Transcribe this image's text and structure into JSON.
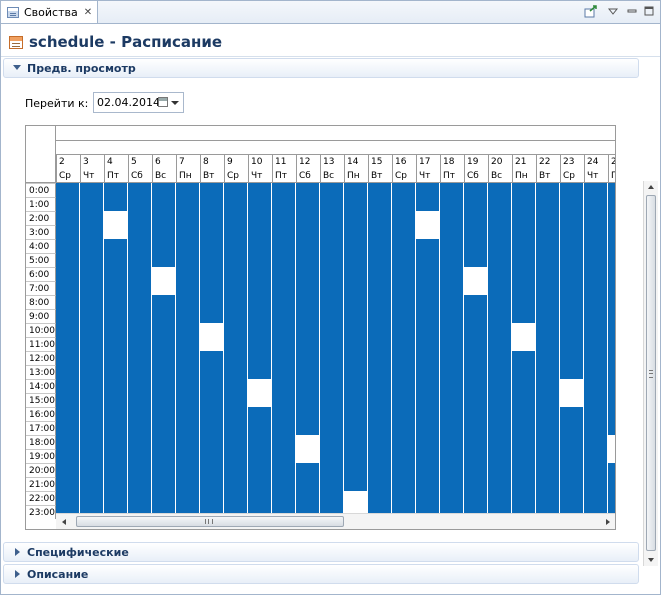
{
  "tab": {
    "label": "Свойства",
    "close": "✕"
  },
  "title": {
    "text": "schedule - Расписание"
  },
  "sections": {
    "preview": "Предв. просмотр",
    "specific": "Специфические",
    "description": "Описание"
  },
  "goto": {
    "label": "Перейти к:",
    "date": "02.04.2014"
  },
  "schedule": {
    "days": [
      {
        "n": "2",
        "w": "Ср"
      },
      {
        "n": "3",
        "w": "Чт"
      },
      {
        "n": "4",
        "w": "Пт"
      },
      {
        "n": "5",
        "w": "Сб"
      },
      {
        "n": "6",
        "w": "Вс"
      },
      {
        "n": "7",
        "w": "Пн"
      },
      {
        "n": "8",
        "w": "Вт"
      },
      {
        "n": "9",
        "w": "Ср"
      },
      {
        "n": "10",
        "w": "Чт"
      },
      {
        "n": "11",
        "w": "Пт"
      },
      {
        "n": "12",
        "w": "Сб"
      },
      {
        "n": "13",
        "w": "Вс"
      },
      {
        "n": "14",
        "w": "Пн"
      },
      {
        "n": "15",
        "w": "Вт"
      },
      {
        "n": "16",
        "w": "Ср"
      },
      {
        "n": "17",
        "w": "Чт"
      },
      {
        "n": "18",
        "w": "Пт"
      },
      {
        "n": "19",
        "w": "Сб"
      },
      {
        "n": "20",
        "w": "Вс"
      },
      {
        "n": "21",
        "w": "Пн"
      },
      {
        "n": "22",
        "w": "Вт"
      },
      {
        "n": "23",
        "w": "Ср"
      },
      {
        "n": "24",
        "w": "Чт"
      },
      {
        "n": "25",
        "w": "П"
      }
    ],
    "hours": [
      "0:00",
      "1:00",
      "2:00",
      "3:00",
      "4:00",
      "5:00",
      "6:00",
      "7:00",
      "8:00",
      "9:00",
      "10:00",
      "11:00",
      "12:00",
      "13:00",
      "14:00",
      "15:00",
      "16:00",
      "17:00",
      "18:00",
      "19:00",
      "20:00",
      "21:00",
      "22:00",
      "23:00"
    ],
    "gaps": [
      {
        "day": 2,
        "start": 2,
        "len": 2
      },
      {
        "day": 4,
        "start": 6,
        "len": 2
      },
      {
        "day": 6,
        "start": 10,
        "len": 2
      },
      {
        "day": 8,
        "start": 14,
        "len": 2
      },
      {
        "day": 10,
        "start": 18,
        "len": 2
      },
      {
        "day": 12,
        "start": 22,
        "len": 2
      },
      {
        "day": 15,
        "start": 2,
        "len": 2
      },
      {
        "day": 17,
        "start": 6,
        "len": 2
      },
      {
        "day": 19,
        "start": 10,
        "len": 2
      },
      {
        "day": 21,
        "start": 14,
        "len": 2
      },
      {
        "day": 23,
        "start": 18,
        "len": 2
      }
    ],
    "active_color": "#0b6bb9",
    "inactive_color": "#ffffff"
  },
  "icons": {
    "tab": "properties-icon",
    "title": "schedule-icon",
    "calendar": "calendar-icon",
    "dropdown": "chevron-down-icon"
  }
}
